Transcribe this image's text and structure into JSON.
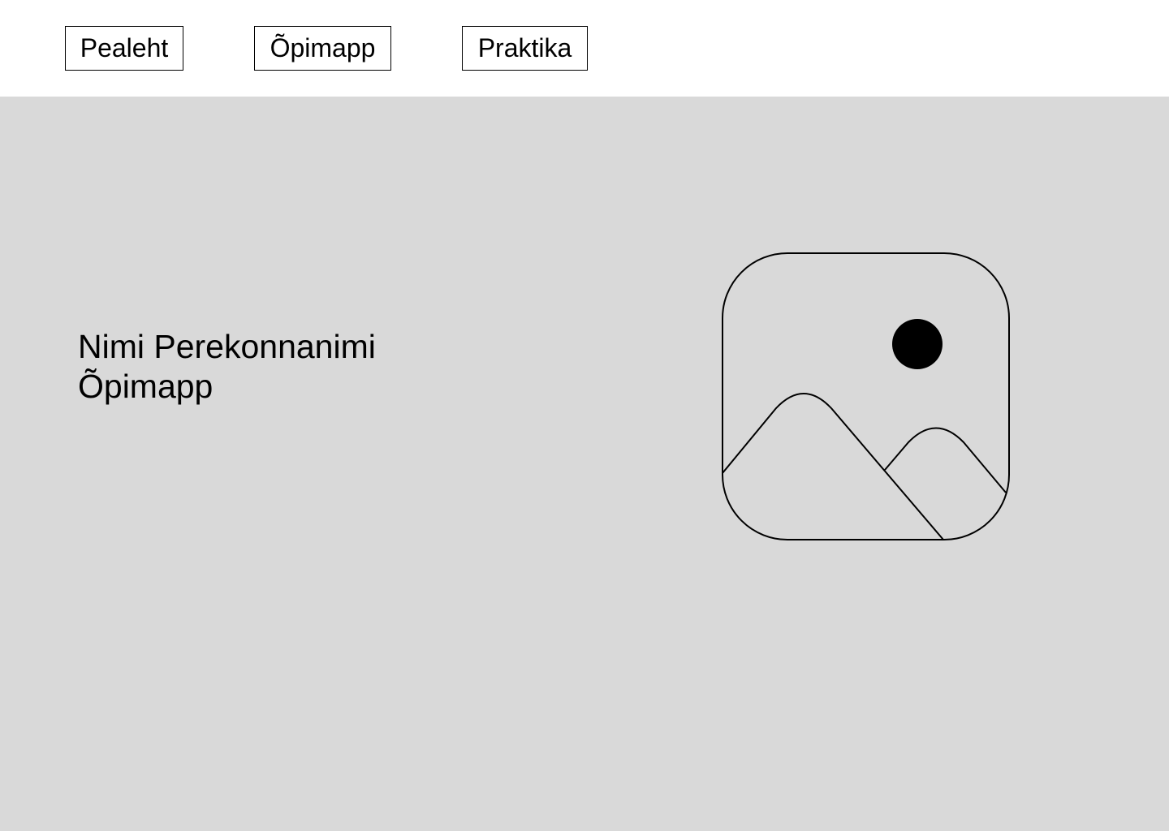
{
  "nav": {
    "items": [
      {
        "label": "Pealeht"
      },
      {
        "label": "Õpimapp"
      },
      {
        "label": "Praktika"
      }
    ]
  },
  "hero": {
    "name": "Nimi Perekonnanimi",
    "subtitle": "Õpimapp",
    "image_icon": "image-placeholder-icon"
  },
  "colors": {
    "page_background": "#ffffff",
    "hero_background": "#d9d9d9",
    "stroke": "#000000"
  }
}
